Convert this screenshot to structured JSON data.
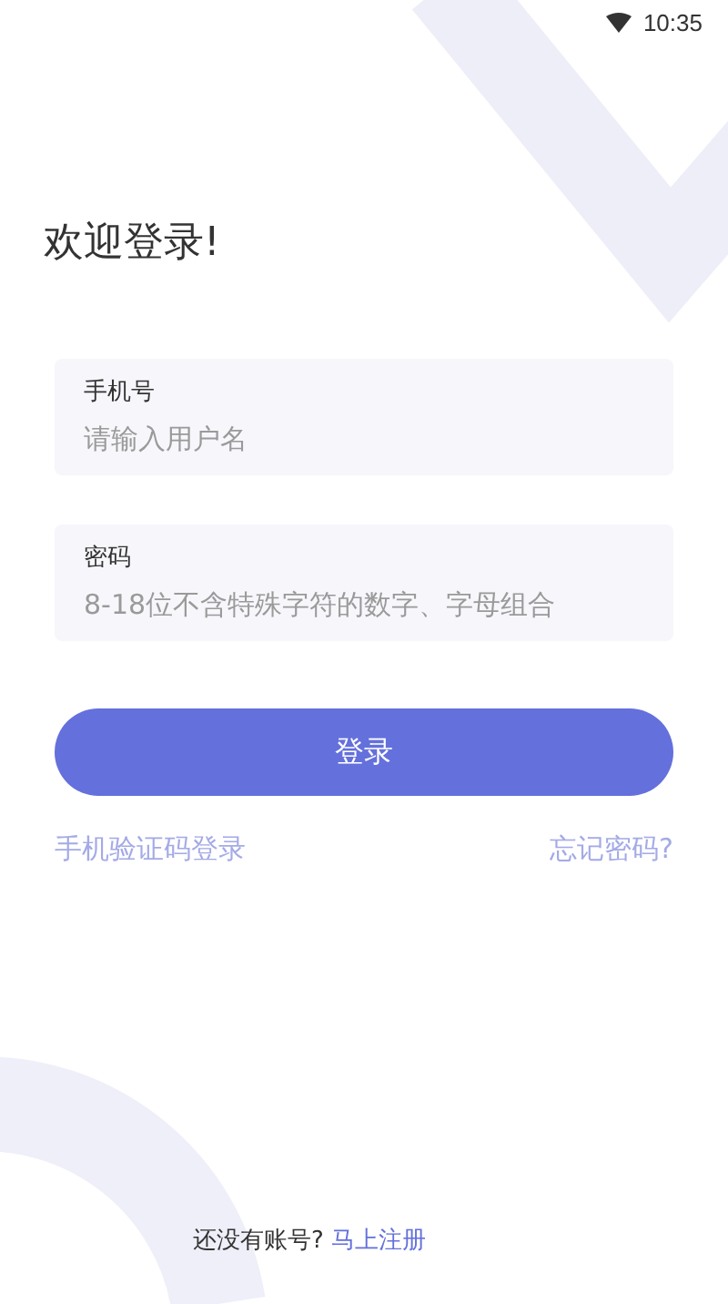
{
  "status_bar": {
    "time": "10:35"
  },
  "heading": "欢迎登录!",
  "fields": [
    {
      "label": "手机号",
      "placeholder": "请输入用户名"
    },
    {
      "label": "密码",
      "placeholder": "8-18位不含特殊字符的数字、字母组合"
    }
  ],
  "login_button": "登录",
  "sms_login_link": "手机验证码登录",
  "forgot_password_link": "忘记密码?",
  "signup": {
    "prompt": "还没有账号?",
    "link": "马上注册"
  }
}
